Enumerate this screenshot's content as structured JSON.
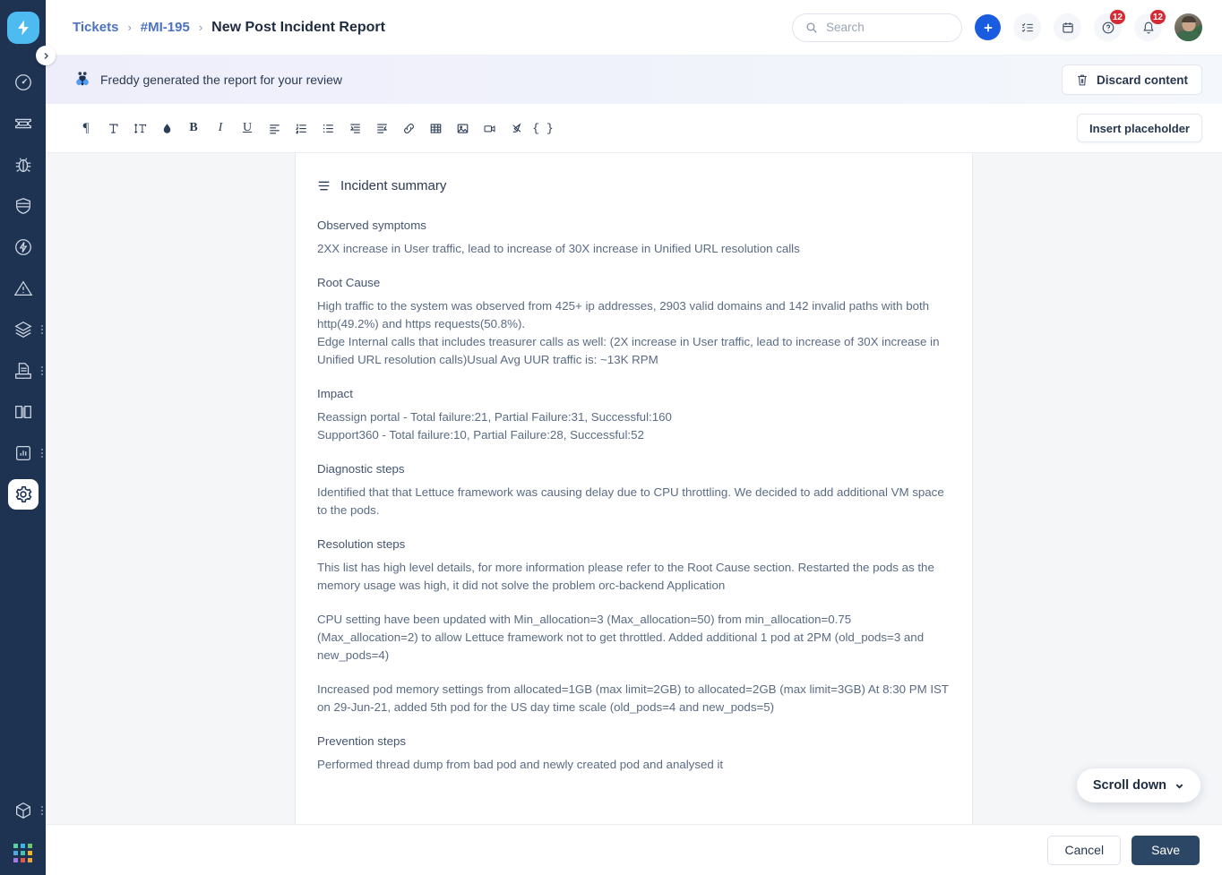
{
  "sidebar": {
    "logo": "freshservice-logo",
    "items": [
      {
        "name": "dashboard",
        "icon": "speedometer-icon",
        "active": false,
        "has_menu": false
      },
      {
        "name": "tickets",
        "icon": "ticket-icon",
        "active": false,
        "has_menu": false
      },
      {
        "name": "problems",
        "icon": "bug-icon",
        "active": false,
        "has_menu": false
      },
      {
        "name": "changes",
        "icon": "shield-icon",
        "active": false,
        "has_menu": false
      },
      {
        "name": "releases",
        "icon": "lightning-circle-icon",
        "active": false,
        "has_menu": false
      },
      {
        "name": "incidents",
        "icon": "alert-triangle-icon",
        "active": false,
        "has_menu": false
      },
      {
        "name": "assets",
        "icon": "layers-icon",
        "active": false,
        "has_menu": true
      },
      {
        "name": "contracts",
        "icon": "document-tray-icon",
        "active": false,
        "has_menu": true
      },
      {
        "name": "solutions",
        "icon": "book-icon",
        "active": false,
        "has_menu": false
      },
      {
        "name": "analytics",
        "icon": "bar-chart-icon",
        "active": false,
        "has_menu": true
      },
      {
        "name": "admin",
        "icon": "gear-icon",
        "active": true,
        "has_menu": false
      }
    ],
    "bottom_items": [
      {
        "name": "marketplace",
        "icon": "cube-icon",
        "has_menu": true
      },
      {
        "name": "app-switcher",
        "icon": "grid-dots-icon",
        "has_menu": false
      }
    ],
    "collapse": "chevron-right-icon",
    "grid_colors": [
      "#5fd0a0",
      "#37b6e9",
      "#6ec96e",
      "#4fa8de",
      "#f0b429",
      "#49c2b0",
      "#a07be0",
      "#e2574c",
      "#f0a33c"
    ]
  },
  "topbar": {
    "breadcrumb": [
      {
        "label": "Tickets",
        "type": "link"
      },
      {
        "label": "#MI-195",
        "type": "link"
      },
      {
        "label": "New Post Incident Report",
        "type": "current"
      }
    ],
    "separator": "›",
    "search": {
      "placeholder": "Search",
      "value": "",
      "icon": "search-icon"
    },
    "actions": [
      {
        "name": "add-new-button",
        "icon": "plus-icon",
        "badge": ""
      },
      {
        "name": "tasks-button",
        "icon": "checklist-icon",
        "badge": ""
      },
      {
        "name": "calendar-button",
        "icon": "calendar-icon",
        "badge": ""
      },
      {
        "name": "help-button",
        "icon": "question-circle-icon",
        "badge": "12"
      },
      {
        "name": "notifications-button",
        "icon": "bell-icon",
        "badge": "12"
      }
    ],
    "avatar": "user-avatar"
  },
  "banner": {
    "icon": "freddy-ai-icon",
    "message": "Freddy generated the report for your review",
    "discard_label": "Discard content",
    "discard_icon": "trash-icon"
  },
  "toolbar": {
    "groups": [
      [
        {
          "name": "paragraph-style-button",
          "icon": "pilcrow-icon",
          "glyph": "¶"
        },
        {
          "name": "font-family-button",
          "icon": "font-icon",
          "glyph": "T"
        },
        {
          "name": "line-height-button",
          "icon": "line-height-icon",
          "glyph": "↕T"
        },
        {
          "name": "text-color-button",
          "icon": "droplet-icon",
          "glyph": "●"
        },
        {
          "name": "bold-button",
          "icon": "bold-icon",
          "glyph": "B"
        },
        {
          "name": "italic-button",
          "icon": "italic-icon",
          "glyph": "I"
        },
        {
          "name": "underline-button",
          "icon": "underline-icon",
          "glyph": "U"
        },
        {
          "name": "align-button",
          "icon": "align-left-icon",
          "glyph": ""
        },
        {
          "name": "ordered-list-button",
          "icon": "ordered-list-icon",
          "glyph": ""
        },
        {
          "name": "bullet-list-button",
          "icon": "bullet-list-icon",
          "glyph": ""
        },
        {
          "name": "indent-button",
          "icon": "indent-icon",
          "glyph": ""
        },
        {
          "name": "outdent-button",
          "icon": "outdent-icon",
          "glyph": ""
        },
        {
          "name": "link-button",
          "icon": "link-icon",
          "glyph": ""
        },
        {
          "name": "table-button",
          "icon": "table-icon",
          "glyph": ""
        },
        {
          "name": "image-button",
          "icon": "image-icon",
          "glyph": ""
        },
        {
          "name": "video-button",
          "icon": "video-icon",
          "glyph": ""
        },
        {
          "name": "clear-format-button",
          "icon": "clear-format-icon",
          "glyph": ""
        },
        {
          "name": "code-block-button",
          "icon": "code-braces-icon",
          "glyph": "{ }"
        }
      ]
    ],
    "insert_placeholder_label": "Insert placeholder"
  },
  "document": {
    "section_icon": "list-lines-icon",
    "section_title": "Incident summary",
    "blocks": [
      {
        "type": "heading",
        "text": "Observed symptoms"
      },
      {
        "type": "paragraph",
        "text": "2XX increase in User traffic, lead to increase of 30X increase in Unified URL resolution calls"
      },
      {
        "type": "heading",
        "text": "Root Cause"
      },
      {
        "type": "paragraph",
        "text": "High traffic to the system was observed from 425+ ip addresses, 2903 valid domains and 142 invalid paths with both http(49.2%) and https requests(50.8%)."
      },
      {
        "type": "paragraph",
        "text": "Edge Internal calls that includes treasurer calls as well: (2X increase in User traffic, lead to increase of 30X increase in Unified URL resolution calls)Usual Avg UUR traffic is: ~13K RPM"
      },
      {
        "type": "heading",
        "text": "Impact"
      },
      {
        "type": "paragraph",
        "text": "Reassign portal - Total failure:21, Partial Failure:31, Successful:160"
      },
      {
        "type": "paragraph",
        "text": "Support360 - Total failure:10, Partial Failure:28, Successful:52"
      },
      {
        "type": "heading",
        "text": "Diagnostic steps"
      },
      {
        "type": "paragraph",
        "text": "Identified that that Lettuce framework was causing delay due to CPU throttling. We decided to add additional VM space to the pods."
      },
      {
        "type": "heading",
        "text": "Resolution steps"
      },
      {
        "type": "paragraph",
        "text": "This list has high level details, for more information please refer to the Root Cause section. Restarted the pods as the memory usage was high, it did not solve the problem orc-backend Application"
      },
      {
        "type": "spacer"
      },
      {
        "type": "paragraph",
        "text": "CPU setting have been updated with Min_allocation=3 (Max_allocation=50) from min_allocation=0.75 (Max_allocation=2) to allow Lettuce framework not to get throttled. Added additional 1 pod at 2PM (old_pods=3 and new_pods=4)"
      },
      {
        "type": "spacer"
      },
      {
        "type": "paragraph",
        "text": "Increased pod memory settings from allocated=1GB (max limit=2GB) to allocated=2GB (max limit=3GB) At 8:30 PM IST on 29-Jun-21, added 5th pod for the US day time scale (old_pods=4 and new_pods=5)"
      },
      {
        "type": "heading",
        "text": "Prevention steps"
      },
      {
        "type": "paragraph",
        "text": "Performed thread dump from bad pod and newly created pod and analysed it"
      }
    ]
  },
  "scroll_pill": {
    "label": "Scroll down",
    "icon": "chevron-down-icon"
  },
  "footer": {
    "cancel_label": "Cancel",
    "save_label": "Save"
  },
  "colors": {
    "rail_bg": "#1e3252",
    "brand_blue": "#4dbbf0",
    "link_blue": "#4c72c4",
    "accent_blue": "#1a5ce0",
    "badge_red": "#d62b34",
    "primary_btn": "#2c4765",
    "canvas_bg": "#f4f6f8"
  }
}
